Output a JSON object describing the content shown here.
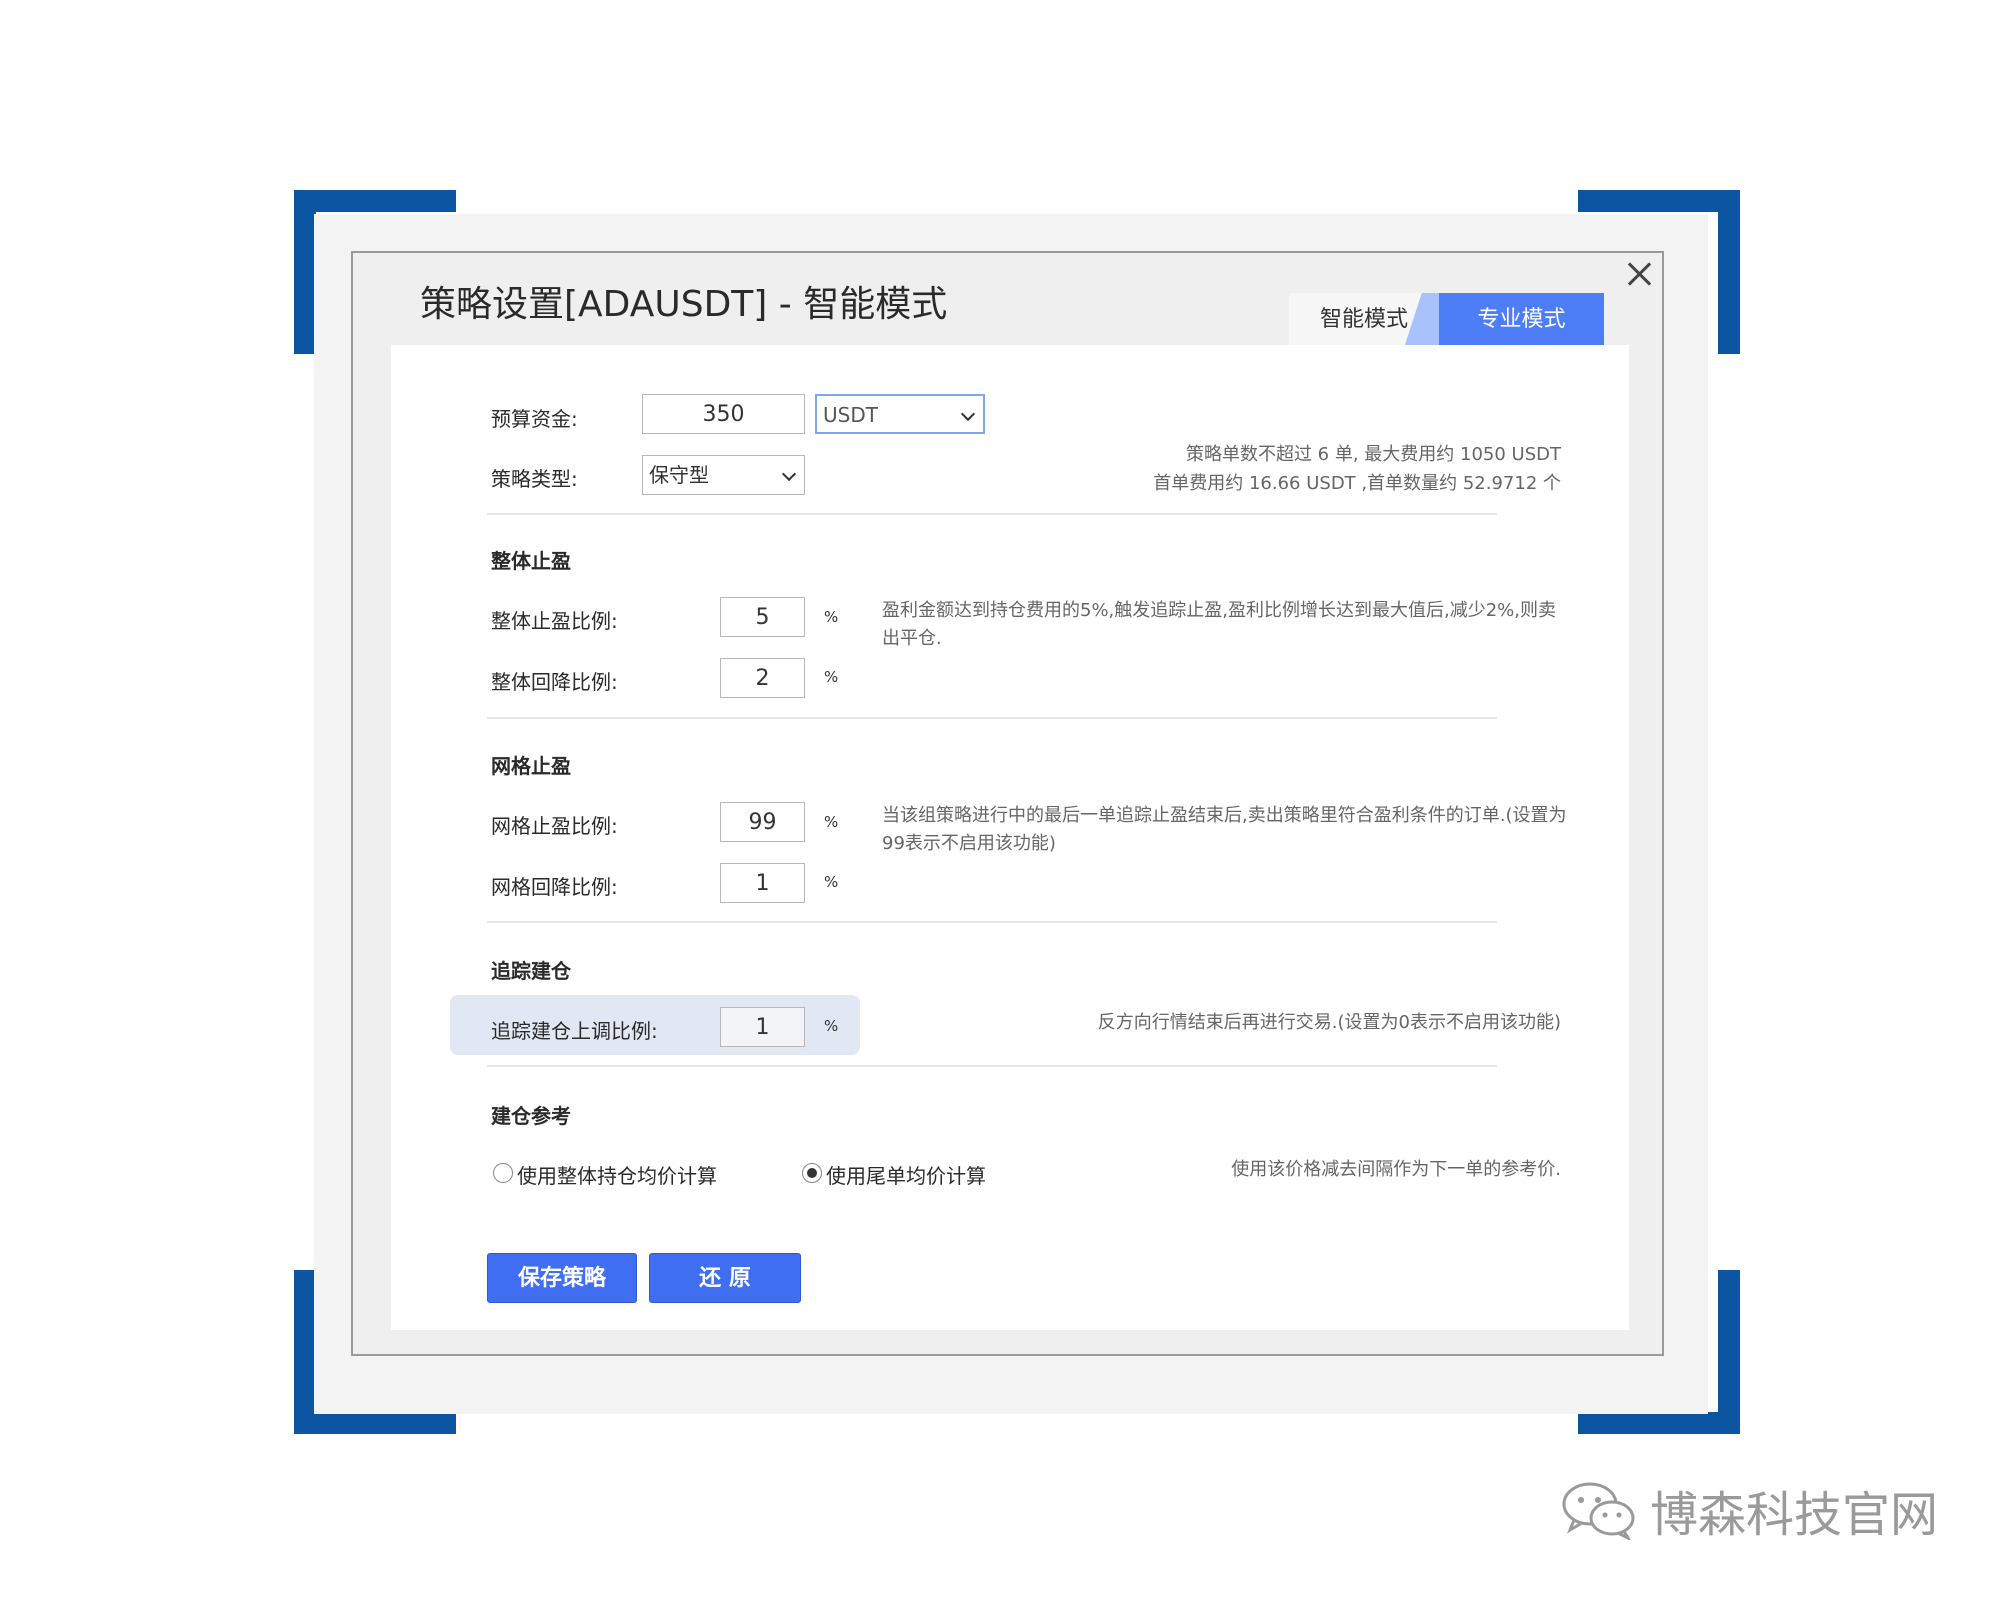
{
  "dialog": {
    "title": "策略设置[ADAUSDT] - 智能模式",
    "tabs": [
      {
        "label": "智能模式",
        "active": false
      },
      {
        "label": "专业模式",
        "active": true
      }
    ]
  },
  "budget": {
    "label": "预算资金:",
    "value": "350",
    "currency": "USDT"
  },
  "strategy_type": {
    "label": "策略类型:",
    "value": "保守型"
  },
  "summary": {
    "line1": "策略单数不超过 6 单, 最大费用约 1050 USDT",
    "line2": "首单费用约 16.66 USDT ,首单数量约 52.9712 个"
  },
  "overall_tp": {
    "title": "整体止盈",
    "ratio_label": "整体止盈比例:",
    "ratio_value": "5",
    "pullback_label": "整体回降比例:",
    "pullback_value": "2",
    "unit": "%",
    "hint": "盈利金额达到持仓费用的5%,触发追踪止盈,盈利比例增长达到最大值后,减少2%,则卖出平仓."
  },
  "grid_tp": {
    "title": "网格止盈",
    "ratio_label": "网格止盈比例:",
    "ratio_value": "99",
    "pullback_label": "网格回降比例:",
    "pullback_value": "1",
    "unit": "%",
    "hint": "当该组策略进行中的最后一单追踪止盈结束后,卖出策略里符合盈利条件的订单.(设置为99表示不启用该功能)"
  },
  "trailing": {
    "title": "追踪建仓",
    "label": "追踪建仓上调比例:",
    "value": "1",
    "unit": "%",
    "hint": "反方向行情结束后再进行交易.(设置为0表示不启用该功能)"
  },
  "reference": {
    "title": "建仓参考",
    "option1": "使用整体持仓均价计算",
    "option2": "使用尾单均价计算",
    "selected": "option2",
    "hint": "使用该价格减去间隔作为下一单的参考价."
  },
  "buttons": {
    "save": "保存策略",
    "reset": "还 原"
  },
  "branding": {
    "text": "博森科技官网"
  },
  "colors": {
    "accent": "#3f6ef2",
    "frame": "#0c55a2",
    "tab_active": "#4d7ef7"
  }
}
